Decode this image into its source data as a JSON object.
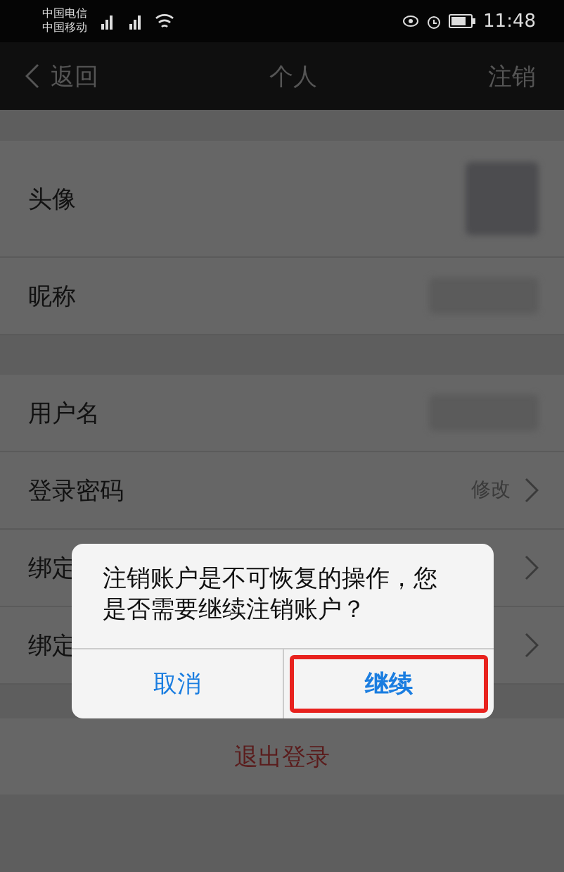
{
  "status_bar": {
    "carriers": [
      "中国电信",
      "中国移动"
    ],
    "time": "11:48"
  },
  "nav": {
    "back": "返回",
    "title": "个人",
    "action": "注销"
  },
  "sections": [
    {
      "rows": [
        {
          "label": "头像",
          "kind": "avatar"
        },
        {
          "label": "昵称",
          "kind": "blurred"
        }
      ]
    },
    {
      "rows": [
        {
          "label": "用户名",
          "kind": "blurred"
        },
        {
          "label": "登录密码",
          "kind": "link",
          "value": "修改"
        },
        {
          "label": "绑定",
          "kind": "chevron"
        },
        {
          "label": "绑定",
          "kind": "chevron"
        }
      ]
    }
  ],
  "logout": "退出登录",
  "dialog": {
    "message": "注销账户是不可恢复的操作，您是否需要继续注销账户？",
    "buttons": [
      {
        "label": "取消",
        "highlighted": false
      },
      {
        "label": "继续",
        "highlighted": true
      }
    ]
  }
}
